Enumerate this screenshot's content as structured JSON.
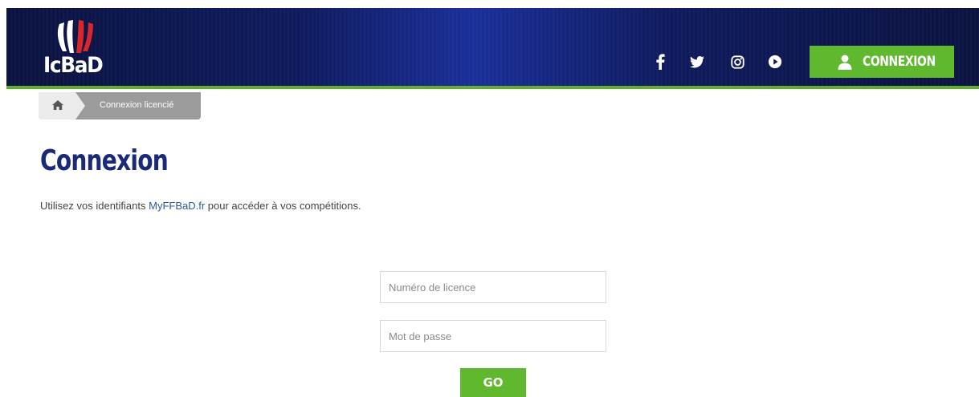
{
  "header": {
    "logo_text": "IcBaD",
    "social": [
      "facebook-icon",
      "twitter-icon",
      "instagram-icon",
      "youtube-icon"
    ],
    "connexion_label": "CONNEXION",
    "accent": "#5fb82e",
    "navy": "#0f1b5e"
  },
  "breadcrumb": {
    "current": "Connexion licencié"
  },
  "main": {
    "title": "Connexion",
    "intro_before": "Utilisez vos identifiants ",
    "intro_link": "MyFFBaD.fr",
    "intro_after": " pour accéder à vos compétitions.",
    "licence_placeholder": "Numéro de licence",
    "password_placeholder": "Mot de passe",
    "go_label": "GO"
  }
}
